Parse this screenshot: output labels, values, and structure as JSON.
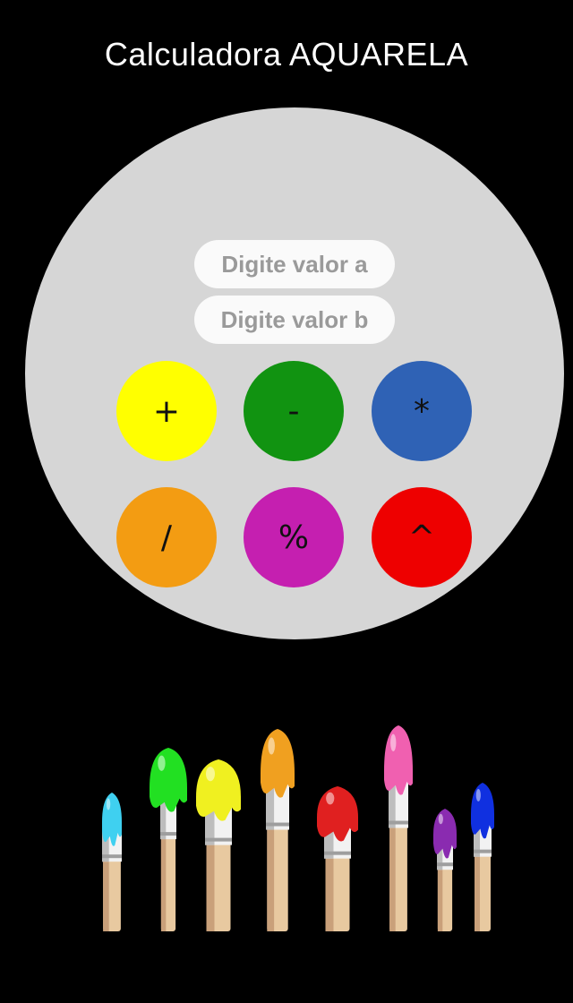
{
  "app": {
    "title": "Calculadora AQUARELA"
  },
  "inputs": {
    "a_placeholder": "Digite valor a",
    "b_placeholder": "Digite valor b"
  },
  "operations": [
    {
      "symbol": "+",
      "color": "#ffff00"
    },
    {
      "symbol": "-",
      "color": "#119311"
    },
    {
      "symbol": "*",
      "color": "#2f62b5"
    },
    {
      "symbol": "/",
      "color": "#f39c12"
    },
    {
      "symbol": "%",
      "color": "#c51fb0"
    },
    {
      "symbol": "^",
      "color": "#ee0000"
    }
  ],
  "decoration": {
    "icon": "paint-brushes-illustration",
    "paint_colors": [
      "#3fd0f0",
      "#22e022",
      "#f0f020",
      "#f0a020",
      "#e02020",
      "#f060b0",
      "#8a2bb0",
      "#1030e0"
    ]
  }
}
